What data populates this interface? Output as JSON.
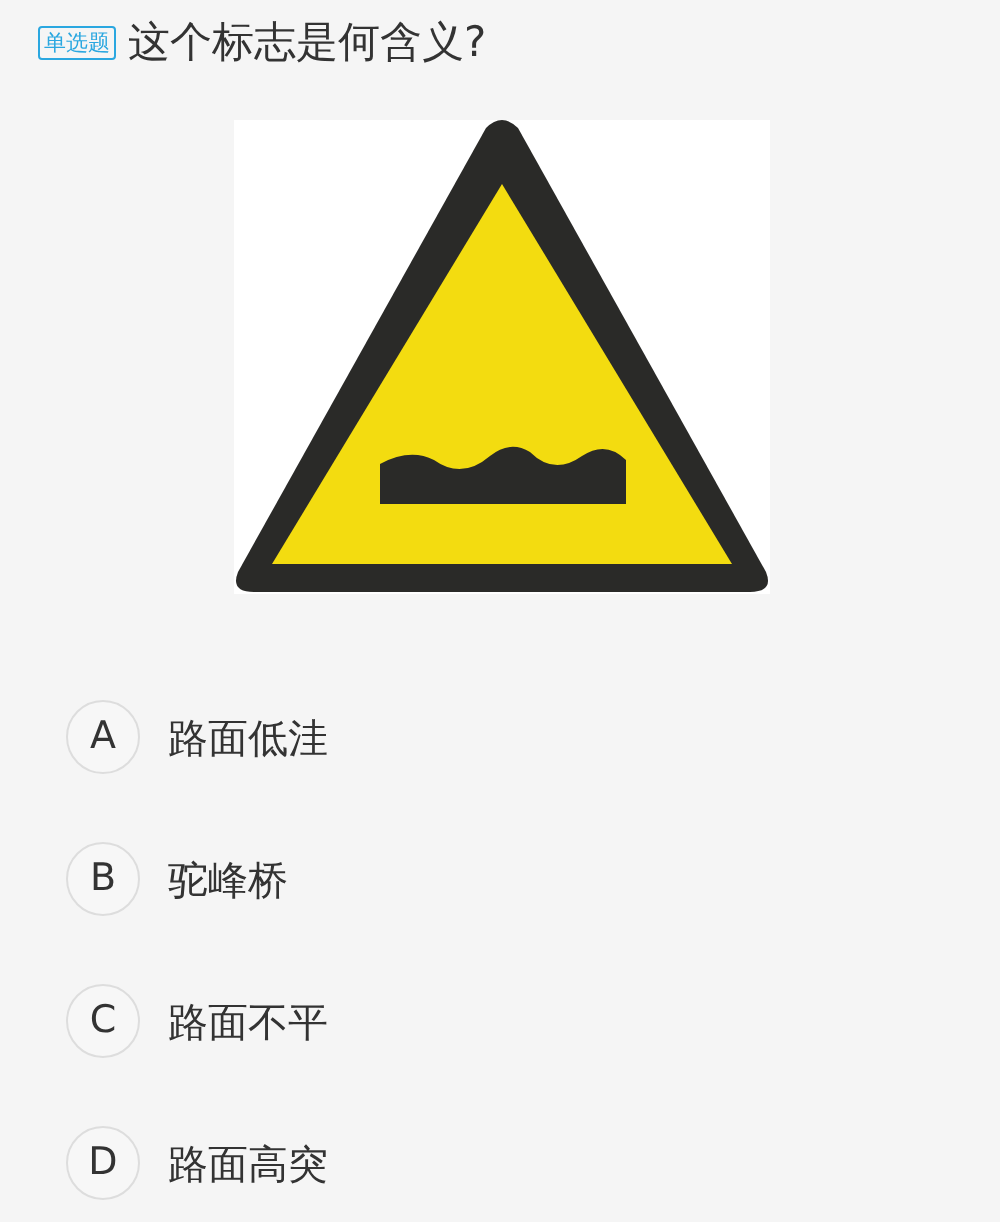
{
  "question": {
    "type_badge": "单选题",
    "text": "这个标志是何含义?"
  },
  "options": [
    {
      "letter": "A",
      "text": "路面低洼"
    },
    {
      "letter": "B",
      "text": "驼峰桥"
    },
    {
      "letter": "C",
      "text": "路面不平"
    },
    {
      "letter": "D",
      "text": "路面高突"
    }
  ]
}
